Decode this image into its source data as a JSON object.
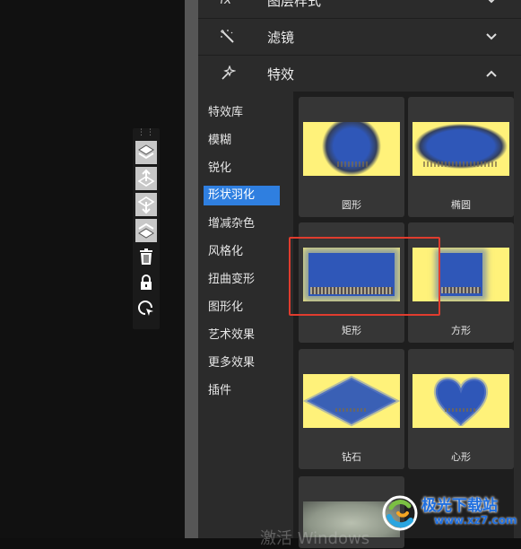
{
  "toolbar": {
    "grip": "⋮⋮",
    "buttons": [
      "layers-up-icon",
      "move-up-icon",
      "move-down-icon",
      "layers-down-icon",
      "delete-icon",
      "lock-icon",
      "select-icon"
    ]
  },
  "sections": {
    "layer_style": "图层样式",
    "filters": "滤镜",
    "effects": "特效"
  },
  "subnav": [
    "特效库",
    "模糊",
    "锐化",
    "形状羽化",
    "增减杂色",
    "风格化",
    "扭曲变形",
    "图形化",
    "艺术效果",
    "更多效果",
    "插件"
  ],
  "active_subnav": "形状羽化",
  "effects": [
    "圆形",
    "椭圆",
    "矩形",
    "方形",
    "钻石",
    "心形"
  ],
  "watermark": "激活 Windows",
  "logo": {
    "brand": "极光下载站",
    "url": "www.xz7.com"
  },
  "colors": {
    "accent": "#2f7fe0",
    "thumb_bg": "#fff27a",
    "photo": "#2f57b8",
    "highlight": "#e03c2e"
  }
}
